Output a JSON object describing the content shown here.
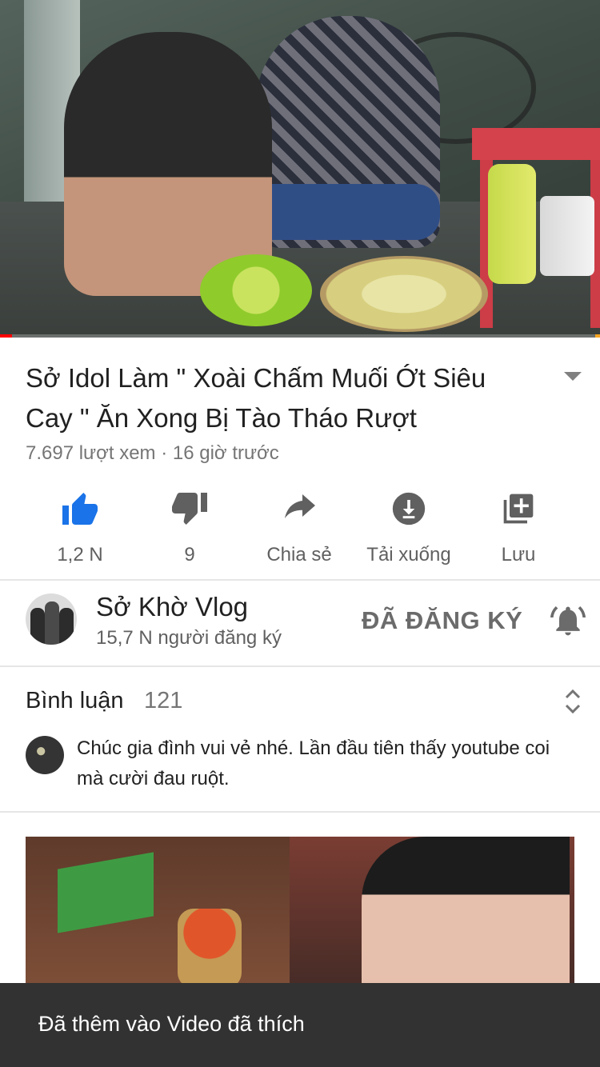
{
  "video": {
    "title": "Sở Idol Làm \" Xoài Chấm Muối Ớt Siêu Cay \" Ăn Xong Bị Tào Tháo Rượt",
    "meta": "7.697 lượt xem · 16 giờ trước",
    "progress_fraction": 0.02
  },
  "actions": [
    {
      "icon": "thumbs-up-icon",
      "label": "1,2 N",
      "active": true
    },
    {
      "icon": "thumbs-down-icon",
      "label": "9",
      "active": false
    },
    {
      "icon": "share-icon",
      "label": "Chia sẻ",
      "active": false
    },
    {
      "icon": "download-icon",
      "label": "Tải xuống",
      "active": false
    },
    {
      "icon": "save-playlist-icon",
      "label": "Lưu",
      "active": false
    }
  ],
  "channel": {
    "name": "Sở Khờ Vlog",
    "subscribers": "15,7 N người đăng ký",
    "subscribed_label": "ĐÃ ĐĂNG KÝ"
  },
  "comments": {
    "label": "Bình luận",
    "count": "121",
    "top_comment": "Chúc gia đình vui vẻ nhé. Lần đầu tiên thấy youtube coi mà cười đau ruột."
  },
  "toast": {
    "message": "Đã thêm vào Video đã thích"
  },
  "colors": {
    "accent_blue": "#1a73e8",
    "icon_gray": "#606060",
    "progress_red": "#ff0000"
  }
}
